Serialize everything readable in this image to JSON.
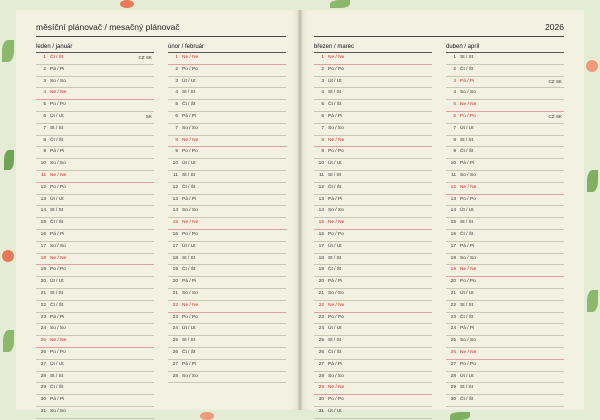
{
  "header": {
    "title": "měsíční plánovač / mesačný plánovač",
    "year": "2026"
  },
  "months": [
    {
      "name": "leden / január",
      "days": [
        {
          "n": "1",
          "d": "Čt / Št",
          "note": "CZ SK",
          "red": true
        },
        {
          "n": "2",
          "d": "Pá / Pi"
        },
        {
          "n": "3",
          "d": "So / So"
        },
        {
          "n": "4",
          "d": "Ne / Ne",
          "sun": true
        },
        {
          "n": "5",
          "d": "Po / Po"
        },
        {
          "n": "6",
          "d": "Út / Ut",
          "note": "SK"
        },
        {
          "n": "7",
          "d": "St / St"
        },
        {
          "n": "8",
          "d": "Čt / Št"
        },
        {
          "n": "9",
          "d": "Pá / Pi"
        },
        {
          "n": "10",
          "d": "So / So"
        },
        {
          "n": "11",
          "d": "Ne / Ne",
          "sun": true
        },
        {
          "n": "12",
          "d": "Po / Po"
        },
        {
          "n": "13",
          "d": "Út / Ut"
        },
        {
          "n": "14",
          "d": "St / St"
        },
        {
          "n": "15",
          "d": "Čt / Št"
        },
        {
          "n": "16",
          "d": "Pá / Pi"
        },
        {
          "n": "17",
          "d": "So / So"
        },
        {
          "n": "18",
          "d": "Ne / Ne",
          "sun": true
        },
        {
          "n": "19",
          "d": "Po / Po"
        },
        {
          "n": "20",
          "d": "Út / Ut"
        },
        {
          "n": "21",
          "d": "St / St"
        },
        {
          "n": "22",
          "d": "Čt / Št"
        },
        {
          "n": "23",
          "d": "Pá / Pi"
        },
        {
          "n": "24",
          "d": "So / So"
        },
        {
          "n": "25",
          "d": "Ne / Ne",
          "sun": true
        },
        {
          "n": "26",
          "d": "Po / Po"
        },
        {
          "n": "27",
          "d": "Út / Ut"
        },
        {
          "n": "28",
          "d": "St / St"
        },
        {
          "n": "29",
          "d": "Čt / Št"
        },
        {
          "n": "30",
          "d": "Pá / Pi"
        },
        {
          "n": "31",
          "d": "So / So"
        }
      ]
    },
    {
      "name": "únor / február",
      "days": [
        {
          "n": "1",
          "d": "Ne / Ne",
          "sun": true
        },
        {
          "n": "2",
          "d": "Po / Po"
        },
        {
          "n": "3",
          "d": "Út / Ut"
        },
        {
          "n": "4",
          "d": "St / St"
        },
        {
          "n": "5",
          "d": "Čt / Št"
        },
        {
          "n": "6",
          "d": "Pá / Pi"
        },
        {
          "n": "7",
          "d": "So / So"
        },
        {
          "n": "8",
          "d": "Ne / Ne",
          "sun": true
        },
        {
          "n": "9",
          "d": "Po / Po"
        },
        {
          "n": "10",
          "d": "Út / Ut"
        },
        {
          "n": "11",
          "d": "St / St"
        },
        {
          "n": "12",
          "d": "Čt / Št"
        },
        {
          "n": "13",
          "d": "Pá / Pi"
        },
        {
          "n": "14",
          "d": "So / So"
        },
        {
          "n": "15",
          "d": "Ne / Ne",
          "sun": true
        },
        {
          "n": "16",
          "d": "Po / Po"
        },
        {
          "n": "17",
          "d": "Út / Ut"
        },
        {
          "n": "18",
          "d": "St / St"
        },
        {
          "n": "19",
          "d": "Čt / Št"
        },
        {
          "n": "20",
          "d": "Pá / Pi"
        },
        {
          "n": "21",
          "d": "So / So"
        },
        {
          "n": "22",
          "d": "Ne / Ne",
          "sun": true
        },
        {
          "n": "23",
          "d": "Po / Po"
        },
        {
          "n": "24",
          "d": "Út / Ut"
        },
        {
          "n": "25",
          "d": "St / St"
        },
        {
          "n": "26",
          "d": "Čt / Št"
        },
        {
          "n": "27",
          "d": "Pá / Pi"
        },
        {
          "n": "28",
          "d": "So / So"
        }
      ]
    },
    {
      "name": "březen / marec",
      "days": [
        {
          "n": "1",
          "d": "Ne / Ne",
          "sun": true
        },
        {
          "n": "2",
          "d": "Po / Po"
        },
        {
          "n": "3",
          "d": "Út / Ut"
        },
        {
          "n": "4",
          "d": "St / St"
        },
        {
          "n": "5",
          "d": "Čt / Št"
        },
        {
          "n": "6",
          "d": "Pá / Pi"
        },
        {
          "n": "7",
          "d": "So / So"
        },
        {
          "n": "8",
          "d": "Ne / Ne",
          "sun": true
        },
        {
          "n": "9",
          "d": "Po / Po"
        },
        {
          "n": "10",
          "d": "Út / Ut"
        },
        {
          "n": "11",
          "d": "St / St"
        },
        {
          "n": "12",
          "d": "Čt / Št"
        },
        {
          "n": "13",
          "d": "Pá / Pi"
        },
        {
          "n": "14",
          "d": "So / So"
        },
        {
          "n": "15",
          "d": "Ne / Ne",
          "sun": true
        },
        {
          "n": "16",
          "d": "Po / Po"
        },
        {
          "n": "17",
          "d": "Út / Ut"
        },
        {
          "n": "18",
          "d": "St / St"
        },
        {
          "n": "19",
          "d": "Čt / Št"
        },
        {
          "n": "20",
          "d": "Pá / Pi"
        },
        {
          "n": "21",
          "d": "So / So"
        },
        {
          "n": "22",
          "d": "Ne / Ne",
          "sun": true
        },
        {
          "n": "23",
          "d": "Po / Po"
        },
        {
          "n": "24",
          "d": "Út / Ut"
        },
        {
          "n": "25",
          "d": "St / St"
        },
        {
          "n": "26",
          "d": "Čt / Št"
        },
        {
          "n": "27",
          "d": "Pá / Pi"
        },
        {
          "n": "28",
          "d": "So / So"
        },
        {
          "n": "29",
          "d": "Ne / Ne",
          "sun": true
        },
        {
          "n": "30",
          "d": "Po / Po"
        },
        {
          "n": "31",
          "d": "Út / Ut"
        }
      ]
    },
    {
      "name": "duben / apríl",
      "days": [
        {
          "n": "1",
          "d": "St / St"
        },
        {
          "n": "2",
          "d": "Čt / Št"
        },
        {
          "n": "3",
          "d": "Pá / Pi",
          "note": "CZ SK",
          "red": true
        },
        {
          "n": "4",
          "d": "So / So"
        },
        {
          "n": "5",
          "d": "Ne / Ne",
          "sun": true
        },
        {
          "n": "6",
          "d": "Po / Po",
          "note": "CZ SK",
          "red": true
        },
        {
          "n": "7",
          "d": "Út / Ut"
        },
        {
          "n": "8",
          "d": "St / St"
        },
        {
          "n": "9",
          "d": "Čt / Št"
        },
        {
          "n": "10",
          "d": "Pá / Pi"
        },
        {
          "n": "11",
          "d": "So / So"
        },
        {
          "n": "12",
          "d": "Ne / Ne",
          "sun": true
        },
        {
          "n": "13",
          "d": "Po / Po"
        },
        {
          "n": "14",
          "d": "Út / Ut"
        },
        {
          "n": "15",
          "d": "St / St"
        },
        {
          "n": "16",
          "d": "Čt / Št"
        },
        {
          "n": "17",
          "d": "Pá / Pi"
        },
        {
          "n": "18",
          "d": "So / So"
        },
        {
          "n": "19",
          "d": "Ne / Ne",
          "sun": true
        },
        {
          "n": "20",
          "d": "Po / Po"
        },
        {
          "n": "21",
          "d": "Út / Ut"
        },
        {
          "n": "22",
          "d": "St / St"
        },
        {
          "n": "23",
          "d": "Čt / Št"
        },
        {
          "n": "24",
          "d": "Pá / Pi"
        },
        {
          "n": "25",
          "d": "So / So"
        },
        {
          "n": "26",
          "d": "Ne / Ne",
          "sun": true
        },
        {
          "n": "27",
          "d": "Po / Po"
        },
        {
          "n": "28",
          "d": "Út / Ut"
        },
        {
          "n": "29",
          "d": "St / St"
        },
        {
          "n": "30",
          "d": "Čt / Št"
        }
      ]
    }
  ]
}
